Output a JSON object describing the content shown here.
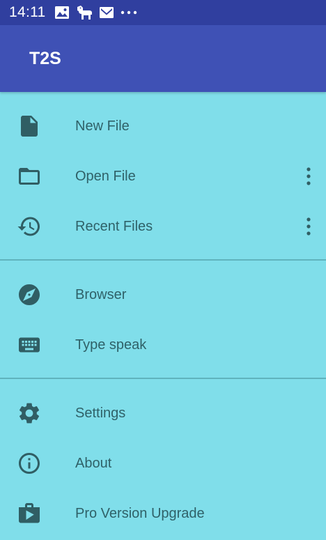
{
  "status_bar": {
    "time": "14:11",
    "icons": [
      "image-icon",
      "dog-icon",
      "mail-icon",
      "more-horizontal-icon"
    ]
  },
  "app_bar": {
    "title": "T2S"
  },
  "menu": {
    "items": [
      {
        "label": "New File",
        "icon": "file-icon"
      },
      {
        "label": "Open File",
        "icon": "folder-icon",
        "overflow": true
      },
      {
        "label": "Recent Files",
        "icon": "history-icon",
        "overflow": true
      },
      {
        "label": "Browser",
        "icon": "compass-icon"
      },
      {
        "label": "Type speak",
        "icon": "keyboard-icon"
      },
      {
        "label": "Settings",
        "icon": "gear-icon"
      },
      {
        "label": "About",
        "icon": "info-icon"
      },
      {
        "label": "Pro Version Upgrade",
        "icon": "shop-play-icon"
      }
    ]
  },
  "colors": {
    "status_bar": "#303f9f",
    "app_bar": "#3f51b5",
    "drawer_background": "#80deea",
    "text": "#2f6168",
    "icon": "#305e64"
  }
}
